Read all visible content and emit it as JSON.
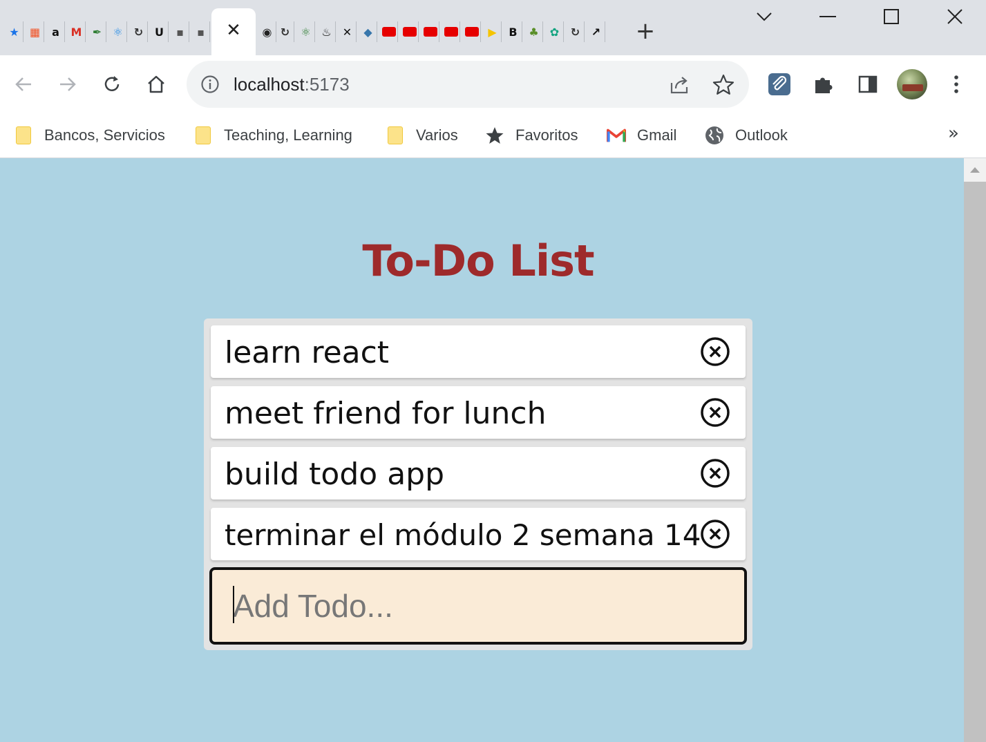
{
  "browser": {
    "tab_icons": [
      {
        "name": "bookmark-star-icon",
        "glyph": "★",
        "color": "#1a73e8"
      },
      {
        "name": "microsoft-icon",
        "glyph": "▦",
        "color": "#f25022"
      },
      {
        "name": "amazon-icon",
        "glyph": "a",
        "color": "#111111"
      },
      {
        "name": "gmail-icon",
        "glyph": "M",
        "color": "#d93025"
      },
      {
        "name": "feather-icon",
        "glyph": "✒",
        "color": "#2e7d32"
      },
      {
        "name": "react-icon",
        "glyph": "⚛",
        "color": "#1e88e5"
      },
      {
        "name": "replit-icon",
        "glyph": "↻",
        "color": "#333333"
      },
      {
        "name": "udemy-icon",
        "glyph": "U",
        "color": "#111111"
      },
      {
        "name": "site-icon",
        "glyph": "▪",
        "color": "#555555"
      },
      {
        "name": "site-icon-2",
        "glyph": "▪",
        "color": "#555555"
      },
      {
        "name": "github-icon",
        "glyph": "◉",
        "color": "#222222"
      },
      {
        "name": "replit-icon-2",
        "glyph": "↻",
        "color": "#333333"
      },
      {
        "name": "react-icon-2",
        "glyph": "⚛",
        "color": "#2e7d32"
      },
      {
        "name": "codewars-icon",
        "glyph": "♨",
        "color": "#111111"
      },
      {
        "name": "x-icon",
        "glyph": "✕",
        "color": "#111111"
      },
      {
        "name": "python-icon",
        "glyph": "◆",
        "color": "#3776ab"
      },
      {
        "name": "youtube-icon",
        "glyph": "",
        "color": "#e60000"
      },
      {
        "name": "youtube-icon-2",
        "glyph": "",
        "color": "#e60000"
      },
      {
        "name": "youtube-icon-3",
        "glyph": "",
        "color": "#e60000"
      },
      {
        "name": "youtube-icon-4",
        "glyph": "",
        "color": "#e60000"
      },
      {
        "name": "youtube-icon-5",
        "glyph": "",
        "color": "#e60000"
      },
      {
        "name": "play-icon",
        "glyph": "▶",
        "color": "#f5c400"
      },
      {
        "name": "bold-b-icon",
        "glyph": "B",
        "color": "#111111"
      },
      {
        "name": "plant-icon",
        "glyph": "♣",
        "color": "#5a8f29"
      },
      {
        "name": "openai-icon",
        "glyph": "✿",
        "color": "#10a37f"
      },
      {
        "name": "replit-icon-3",
        "glyph": "↻",
        "color": "#333333"
      },
      {
        "name": "arrow-icon",
        "glyph": "↗",
        "color": "#111111"
      }
    ],
    "address": {
      "host": "localhost",
      "port": ":5173"
    },
    "bookmarks": [
      {
        "label": "Bancos, Servicios",
        "icon": "folder-icon"
      },
      {
        "label": "Teaching, Learning",
        "icon": "folder-icon"
      },
      {
        "label": "Varios",
        "icon": "folder-icon"
      },
      {
        "label": "Favoritos",
        "icon": "star-icon"
      },
      {
        "label": "Gmail",
        "icon": "gmail-icon"
      },
      {
        "label": "Outlook",
        "icon": "globe-icon"
      }
    ],
    "bookmarks_more": "»"
  },
  "app": {
    "title": "To-Do List",
    "todos": [
      {
        "text": "learn react"
      },
      {
        "text": "meet friend for lunch"
      },
      {
        "text": "build todo app"
      },
      {
        "text": "terminar el módulo 2 semana 14"
      }
    ],
    "input": {
      "placeholder": "Add Todo...",
      "value": ""
    }
  },
  "colors": {
    "page_background": "#add3e3",
    "title": "#9e2a2b",
    "input_background": "#faebd7"
  }
}
